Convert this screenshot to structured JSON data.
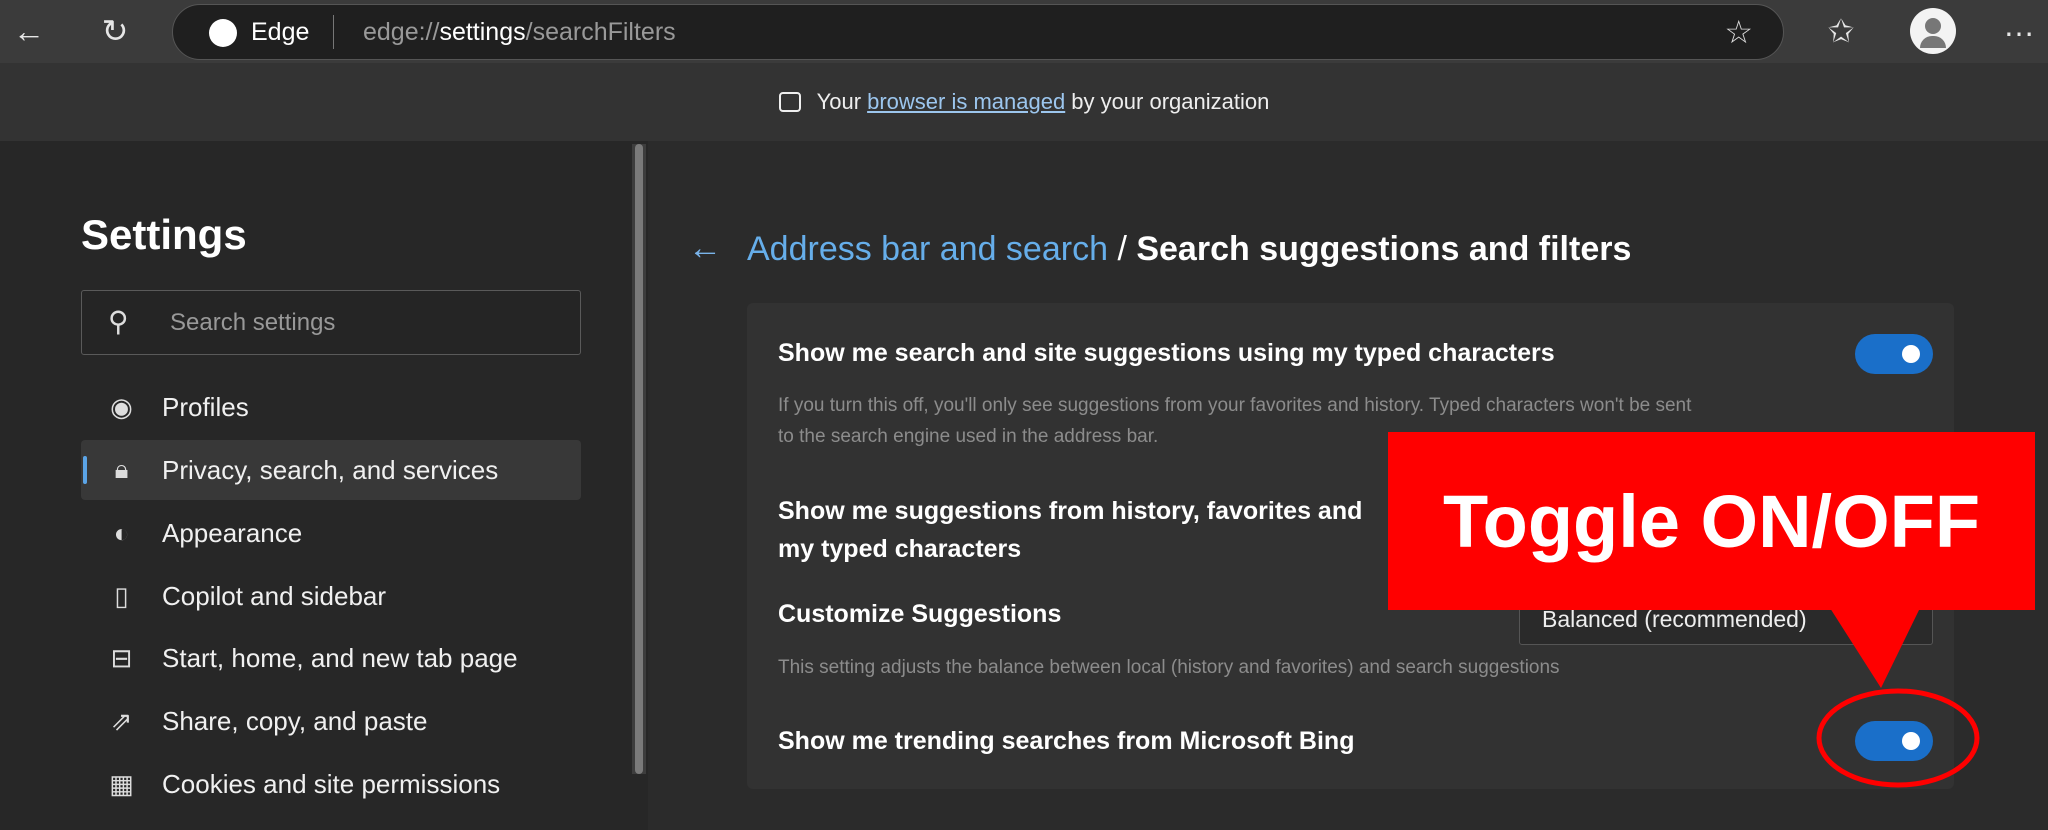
{
  "browser": {
    "brand": "Edge",
    "url_prefix": "edge://",
    "url_bold": "settings",
    "url_suffix": "/searchFilters",
    "icons": [
      "back-icon",
      "refresh-icon",
      "edge-logo-icon",
      "star-icon",
      "favorites-icon",
      "profile-icon",
      "more-icon"
    ]
  },
  "banner": {
    "pre": "Your",
    "link": "browser is managed",
    "post": "by your organization"
  },
  "sidebar": {
    "title": "Settings",
    "search_placeholder": "Search settings",
    "items": [
      {
        "label": "Profiles",
        "icon": "profile-icon"
      },
      {
        "label": "Privacy, search, and services",
        "icon": "lock-icon",
        "selected": true
      },
      {
        "label": "Appearance",
        "icon": "palette-icon"
      },
      {
        "label": "Copilot and sidebar",
        "icon": "sidebar-icon"
      },
      {
        "label": "Start, home, and new tab page",
        "icon": "home-icon"
      },
      {
        "label": "Share, copy, and paste",
        "icon": "share-icon"
      },
      {
        "label": "Cookies and site permissions",
        "icon": "cookies-icon"
      }
    ]
  },
  "main": {
    "breadcrumb_link": "Address bar and search",
    "breadcrumb_sep": "/",
    "title": "Search suggestions and filters",
    "settings": [
      {
        "title": "Show me search and site suggestions using my typed characters",
        "desc1": "If you turn this off, you'll only see suggestions from your favorites and history. Typed characters won't be sent",
        "desc2": "to the search engine used in the address bar.",
        "toggle": true
      },
      {
        "title1": "Show me suggestions from history, favorites and",
        "title2": "my typed characters"
      },
      {
        "title": "Customize Suggestions",
        "value": "Balanced (recommended)",
        "desc": "This setting adjusts the balance between local (history and favorites) and search suggestions"
      },
      {
        "title": "Show me trending searches from Microsoft Bing",
        "toggle": true
      }
    ]
  },
  "annotation": {
    "label": "Toggle ON/OFF",
    "color": "#ff0000"
  }
}
